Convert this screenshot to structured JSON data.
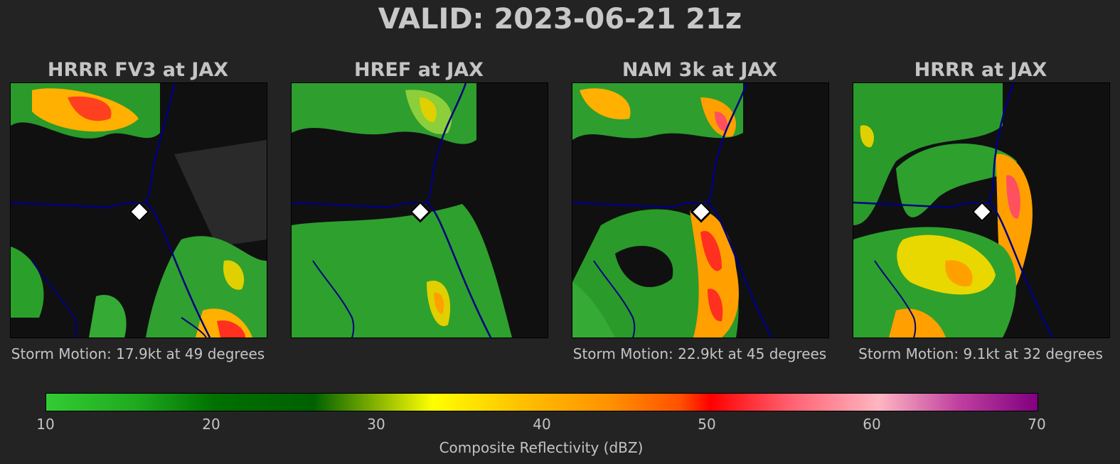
{
  "title": "VALID: 2023-06-21 21z",
  "panels": [
    {
      "title": "HRRR FV3 at JAX",
      "motion": "Storm Motion: 17.9kt at 49 degrees"
    },
    {
      "title": "HREF at JAX",
      "motion": ""
    },
    {
      "title": "NAM 3k at JAX",
      "motion": "Storm Motion: 22.9kt at 45 degrees"
    },
    {
      "title": "HRRR at JAX",
      "motion": "Storm Motion: 9.1kt at 32 degrees"
    }
  ],
  "colorbar": {
    "label": "Composite Reflectivity (dBZ)",
    "ticks": [
      "10",
      "20",
      "30",
      "40",
      "50",
      "60",
      "70"
    ],
    "range": [
      10,
      70
    ]
  },
  "colors": {
    "background": "#232323",
    "map_background": "#101010",
    "boundary": "#000080",
    "low_reflectivity": "#33cc33",
    "high_reflectivity": "#800080"
  }
}
